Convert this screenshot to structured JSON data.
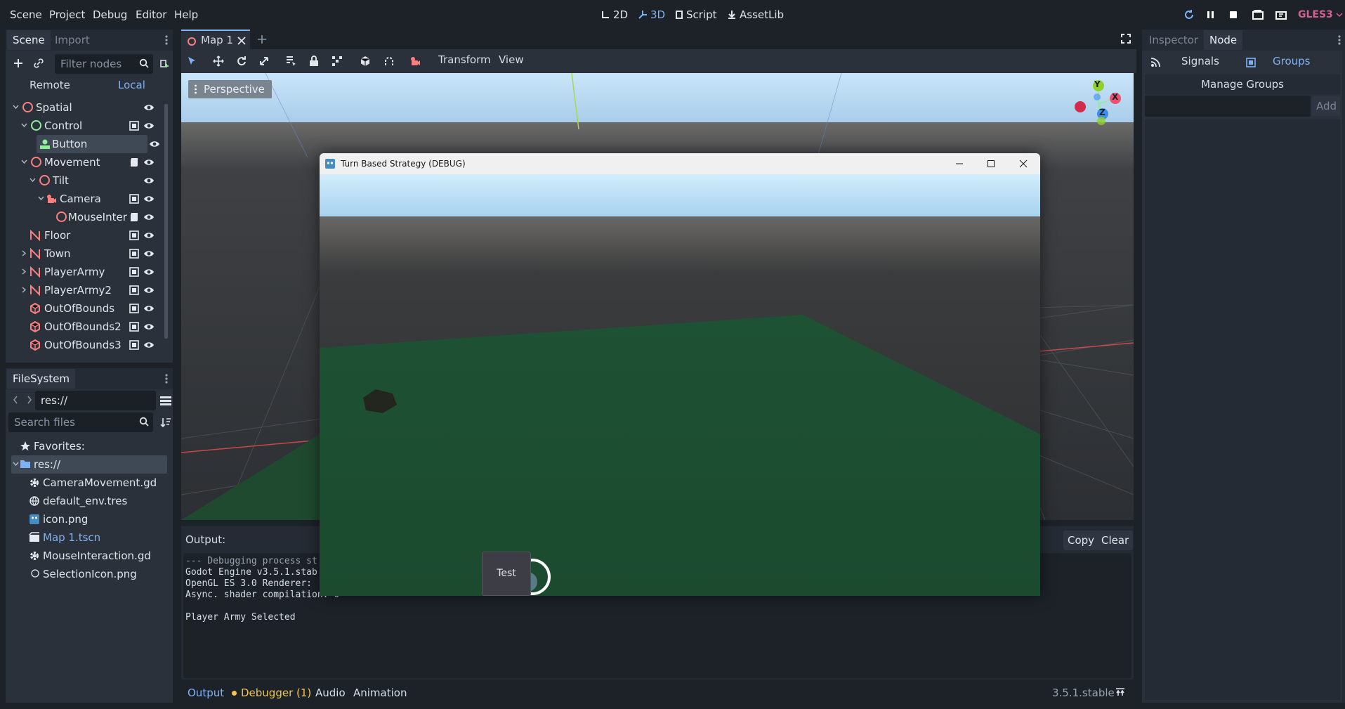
{
  "menu": [
    "Scene",
    "Project",
    "Debug",
    "Editor",
    "Help"
  ],
  "main_modes": {
    "two_d": "2D",
    "three_d": "3D",
    "script": "Script",
    "assetlib": "AssetLib"
  },
  "renderer": "GLES3",
  "scene_dock": {
    "tabs": [
      "Scene",
      "Import"
    ],
    "filter_placeholder": "Filter nodes",
    "remote_label": "Remote",
    "local_label": "Local",
    "nodes": [
      {
        "label": "Spatial"
      },
      {
        "label": "Control"
      },
      {
        "label": "Button"
      },
      {
        "label": "Movement"
      },
      {
        "label": "Tilt"
      },
      {
        "label": "Camera"
      },
      {
        "label": "MouseInter"
      },
      {
        "label": "Floor"
      },
      {
        "label": "Town"
      },
      {
        "label": "PlayerArmy"
      },
      {
        "label": "PlayerArmy2"
      },
      {
        "label": "OutOfBounds"
      },
      {
        "label": "OutOfBounds2"
      },
      {
        "label": "OutOfBounds3"
      }
    ]
  },
  "filesystem": {
    "tab": "FileSystem",
    "path": "res://",
    "search_placeholder": "Search files",
    "favorites": "Favorites:",
    "root": "res://",
    "files": [
      {
        "label": "CameraMovement.gd"
      },
      {
        "label": "default_env.tres"
      },
      {
        "label": "icon.png"
      },
      {
        "label": "Map 1.tscn"
      },
      {
        "label": "MouseInteraction.gd"
      },
      {
        "label": "SelectionIcon.png"
      }
    ]
  },
  "editor": {
    "scene_tab": "Map 1",
    "toolbar_menus": {
      "transform": "Transform",
      "view": "View"
    },
    "viewport_label": "Perspective",
    "gizmo_axes": {
      "y": "Y",
      "x": "X",
      "z": "Z"
    }
  },
  "output": {
    "title": "Output:",
    "copy": "Copy",
    "clear": "Clear",
    "lines": [
      "--- Debugging process st",
      "Godot Engine v3.5.1.stab",
      "OpenGL ES 3.0 Renderer: ",
      "Async. shader compilation: O",
      "",
      "Player Army Selected"
    ]
  },
  "bottom_tabs": {
    "output": "Output",
    "debugger": "Debugger (1)",
    "audio": "Audio",
    "animation": "Animation"
  },
  "version": "3.5.1.stable",
  "inspector_dock": {
    "tabs": [
      "Inspector",
      "Node"
    ],
    "signals": "Signals",
    "groups": "Groups",
    "manage_groups": "Manage Groups",
    "add": "Add"
  },
  "game_window": {
    "title": "Turn Based Strategy (DEBUG)",
    "button_label": "Test"
  },
  "colors": {
    "accent": "#7fb2f5",
    "node_red": "#fc7f7f",
    "control_green": "#8eef97",
    "renderer": "#d65e92"
  }
}
